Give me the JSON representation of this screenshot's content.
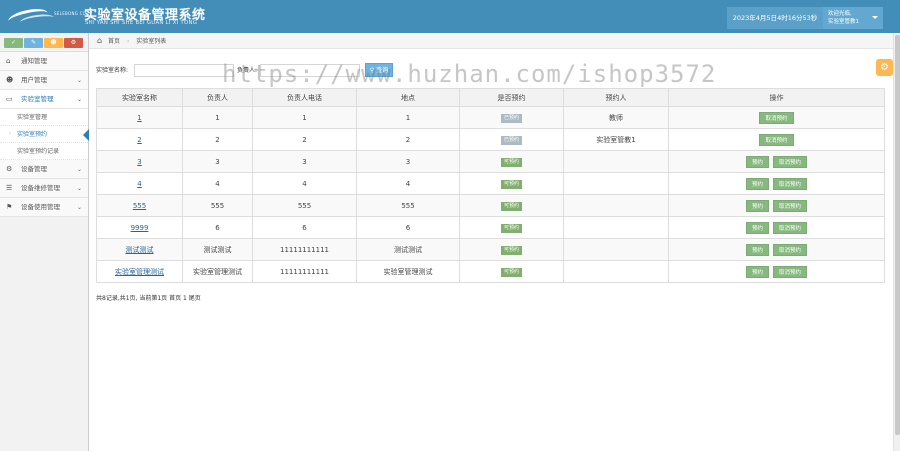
{
  "header": {
    "logo_text": "SELEBONG CO.",
    "title": "实验室设备管理系统",
    "subtitle": "SHI YAN SHI SHE BEI GUAN LI XI TONG",
    "datetime": "2023年4月5日4时16分53秒",
    "welcome": "欢迎光临,",
    "username": "实验室管教1"
  },
  "sidebar": {
    "menu": [
      {
        "label": "通知管理",
        "icon": "home-icon"
      },
      {
        "label": "用户管理",
        "icon": "users-icon"
      },
      {
        "label": "实验室管理",
        "icon": "desktop-icon"
      },
      {
        "label": "设备管理",
        "icon": "cogs-icon"
      },
      {
        "label": "设备维修管理",
        "icon": "list-icon"
      },
      {
        "label": "设备使用管理",
        "icon": "bookmark-icon"
      }
    ],
    "submenu": [
      {
        "label": "实验室管理"
      },
      {
        "label": "实验室预约"
      },
      {
        "label": "实验室预约记录"
      }
    ]
  },
  "breadcrumb": {
    "home": "首页",
    "current": "实验室列表"
  },
  "search": {
    "name_label": "实验室名称:",
    "name_value": "",
    "person_label": "负责人:",
    "person_value": "",
    "button_label": "查询"
  },
  "table": {
    "headers": [
      "实验室名称",
      "负责人",
      "负责人电话",
      "地点",
      "是否预约",
      "预约人",
      "操作"
    ],
    "rows": [
      {
        "name": "1",
        "person": "1",
        "phone": "1",
        "location": "1",
        "status": "已预约",
        "reserver": "教师",
        "actions": [
          "取消预约"
        ]
      },
      {
        "name": "2",
        "person": "2",
        "phone": "2",
        "location": "2",
        "status": "已预约",
        "reserver": "实验室管教1",
        "actions": [
          "取消预约"
        ]
      },
      {
        "name": "3",
        "person": "3",
        "phone": "3",
        "location": "3",
        "status": "可预约",
        "reserver": "",
        "actions": [
          "预约",
          "取消预约"
        ]
      },
      {
        "name": "4",
        "person": "4",
        "phone": "4",
        "location": "4",
        "status": "可预约",
        "reserver": "",
        "actions": [
          "预约",
          "取消预约"
        ]
      },
      {
        "name": "555",
        "person": "555",
        "phone": "555",
        "location": "555",
        "status": "可预约",
        "reserver": "",
        "actions": [
          "预约",
          "取消预约"
        ]
      },
      {
        "name": "9999",
        "person": "6",
        "phone": "6",
        "location": "6",
        "status": "可预约",
        "reserver": "",
        "actions": [
          "预约",
          "取消预约"
        ]
      },
      {
        "name": "测试测试",
        "person": "测试测试",
        "phone": "11111111111",
        "location": "测试测试",
        "status": "可预约",
        "reserver": "",
        "actions": [
          "预约",
          "取消预约"
        ]
      },
      {
        "name": "实验室管理测试",
        "person": "实验室管理测试",
        "phone": "11111111111",
        "location": "实验室管理测试",
        "status": "可预约",
        "reserver": "",
        "actions": [
          "预约",
          "取消预约"
        ]
      }
    ]
  },
  "pager": {
    "text": "共8记录,共1页, 当前第1页 首页 1 尾页"
  },
  "watermark": "https://www.huzhan.com/ishop3572",
  "colors": {
    "header_bg": "#438eb9",
    "reserved_badge": "#abbac3",
    "available_badge": "#82af6f",
    "action_button": "#87b87f",
    "active_link": "#2b7dbc"
  }
}
